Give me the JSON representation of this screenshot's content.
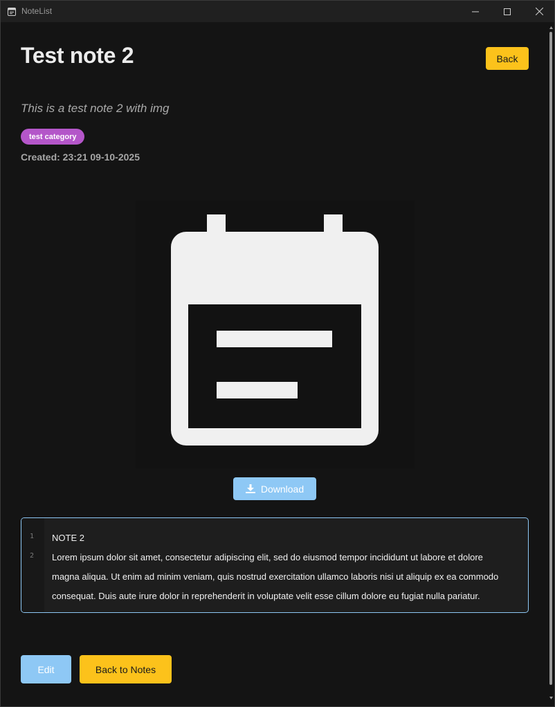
{
  "window": {
    "title": "NoteList"
  },
  "note": {
    "title": "Test note 2",
    "subtitle": "This is a test note 2 with img",
    "category": "test category",
    "created": "Created: 23:21 09-10-2025"
  },
  "buttons": {
    "back": "Back",
    "download": "Download",
    "edit": "Edit",
    "back_to_notes": "Back to Notes"
  },
  "editor": {
    "line_numbers": [
      "1",
      "2"
    ],
    "lines": [
      "NOTE 2",
      "Lorem ipsum dolor sit amet, consectetur adipiscing elit, sed do eiusmod tempor incididunt ut labore et dolore",
      "magna aliqua. Ut enim ad minim veniam, quis nostrud exercitation ullamco laboris nisi ut aliquip ex ea commodo",
      "consequat. Duis aute irure dolor in reprehenderit in voluptate velit esse cillum dolore eu fugiat nulla pariatur."
    ]
  },
  "icons": {
    "app": "notes-icon",
    "image": "calendar-note-icon",
    "download": "download-icon"
  },
  "colors": {
    "accent_yellow": "#fcc21b",
    "accent_blue": "#8ec8f5",
    "category_purple": "#b456c9",
    "background": "#141414"
  }
}
